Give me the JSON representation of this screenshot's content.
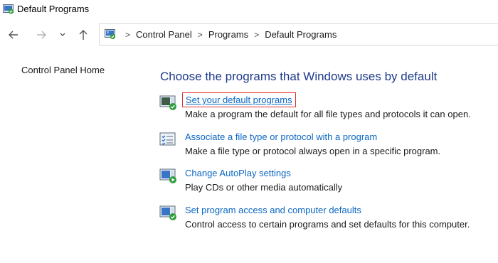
{
  "window": {
    "title": "Default Programs"
  },
  "nav": {
    "back_icon": "back-arrow-icon",
    "forward_icon": "forward-arrow-icon",
    "recent_icon": "chevron-down-icon",
    "up_icon": "up-arrow-icon"
  },
  "breadcrumb": {
    "items": [
      "Control Panel",
      "Programs",
      "Default Programs"
    ],
    "separator": ">"
  },
  "sidebar": {
    "home_link": "Control Panel Home"
  },
  "main": {
    "heading": "Choose the programs that Windows uses by default",
    "tasks": [
      {
        "icon": "default-programs-icon",
        "link": "Set your default programs",
        "description": "Make a program the default for all file types and protocols it can open.",
        "highlighted": true
      },
      {
        "icon": "file-association-icon",
        "link": "Associate a file type or protocol with a program",
        "description": "Make a file type or protocol always open in a specific program.",
        "highlighted": false
      },
      {
        "icon": "autoplay-icon",
        "link": "Change AutoPlay settings",
        "description": "Play CDs or other media automatically",
        "highlighted": false
      },
      {
        "icon": "program-access-icon",
        "link": "Set program access and computer defaults",
        "description": "Control access to certain programs and set defaults for this computer.",
        "highlighted": false
      }
    ]
  },
  "colors": {
    "heading": "#1e3a8a",
    "link": "#0b67c2",
    "highlight_border": "#e0312e"
  }
}
